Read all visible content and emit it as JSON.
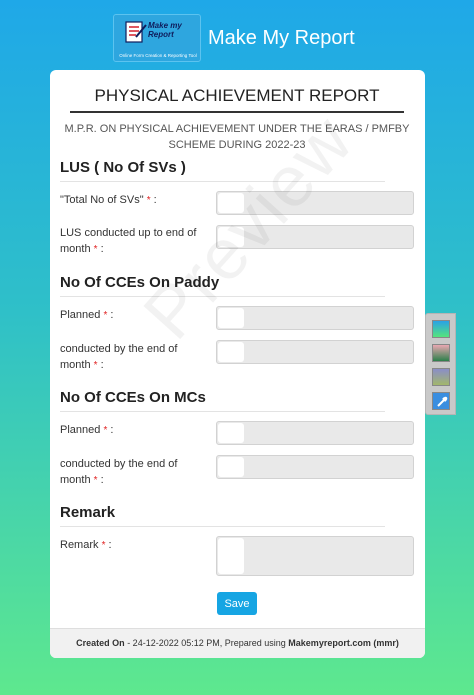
{
  "header": {
    "logo_name": "Make my Report",
    "logo_tagline": "Online Form Creation & Reporting Tool",
    "app_title": "Make My Report"
  },
  "form": {
    "title": "PHYSICAL ACHIEVEMENT REPORT",
    "subtitle": "M.P.R. ON PHYSICAL ACHIEVEMENT UNDER THE EARAS / PMFBY SCHEME DURING 2022-23",
    "watermark": "Preview",
    "required_mark": "*",
    "colon": ":",
    "sections": [
      {
        "title": "LUS ( No Of SVs )",
        "fields": [
          {
            "label": "\"Total No of SVs\"",
            "value": ""
          },
          {
            "label": "LUS conducted up to end of month",
            "value": ""
          }
        ]
      },
      {
        "title": "No Of CCEs On Paddy",
        "fields": [
          {
            "label": "Planned",
            "value": ""
          },
          {
            "label": "conducted by the end of month",
            "value": ""
          }
        ]
      },
      {
        "title": "No Of CCEs On MCs",
        "fields": [
          {
            "label": "Planned",
            "value": ""
          },
          {
            "label": "conducted by the end of month",
            "value": ""
          }
        ]
      },
      {
        "title": "Remark",
        "fields": [
          {
            "label": "Remark",
            "value": ""
          }
        ]
      }
    ],
    "save_label": "Save"
  },
  "footer": {
    "created_label": "Created On",
    "created_value": " - 24-12-2022 05:12 PM, Prepared using ",
    "brand": "Makemyreport.com (mmr)"
  },
  "theme_switcher": {
    "options": [
      "blue-green-theme",
      "pink-green-theme",
      "purple-olive-theme",
      "color-picker"
    ]
  },
  "colors": {
    "accent": "#16a5e3",
    "required": "#e02020",
    "gradient_top": "#1fa8e8",
    "gradient_bottom": "#5ee88e"
  }
}
